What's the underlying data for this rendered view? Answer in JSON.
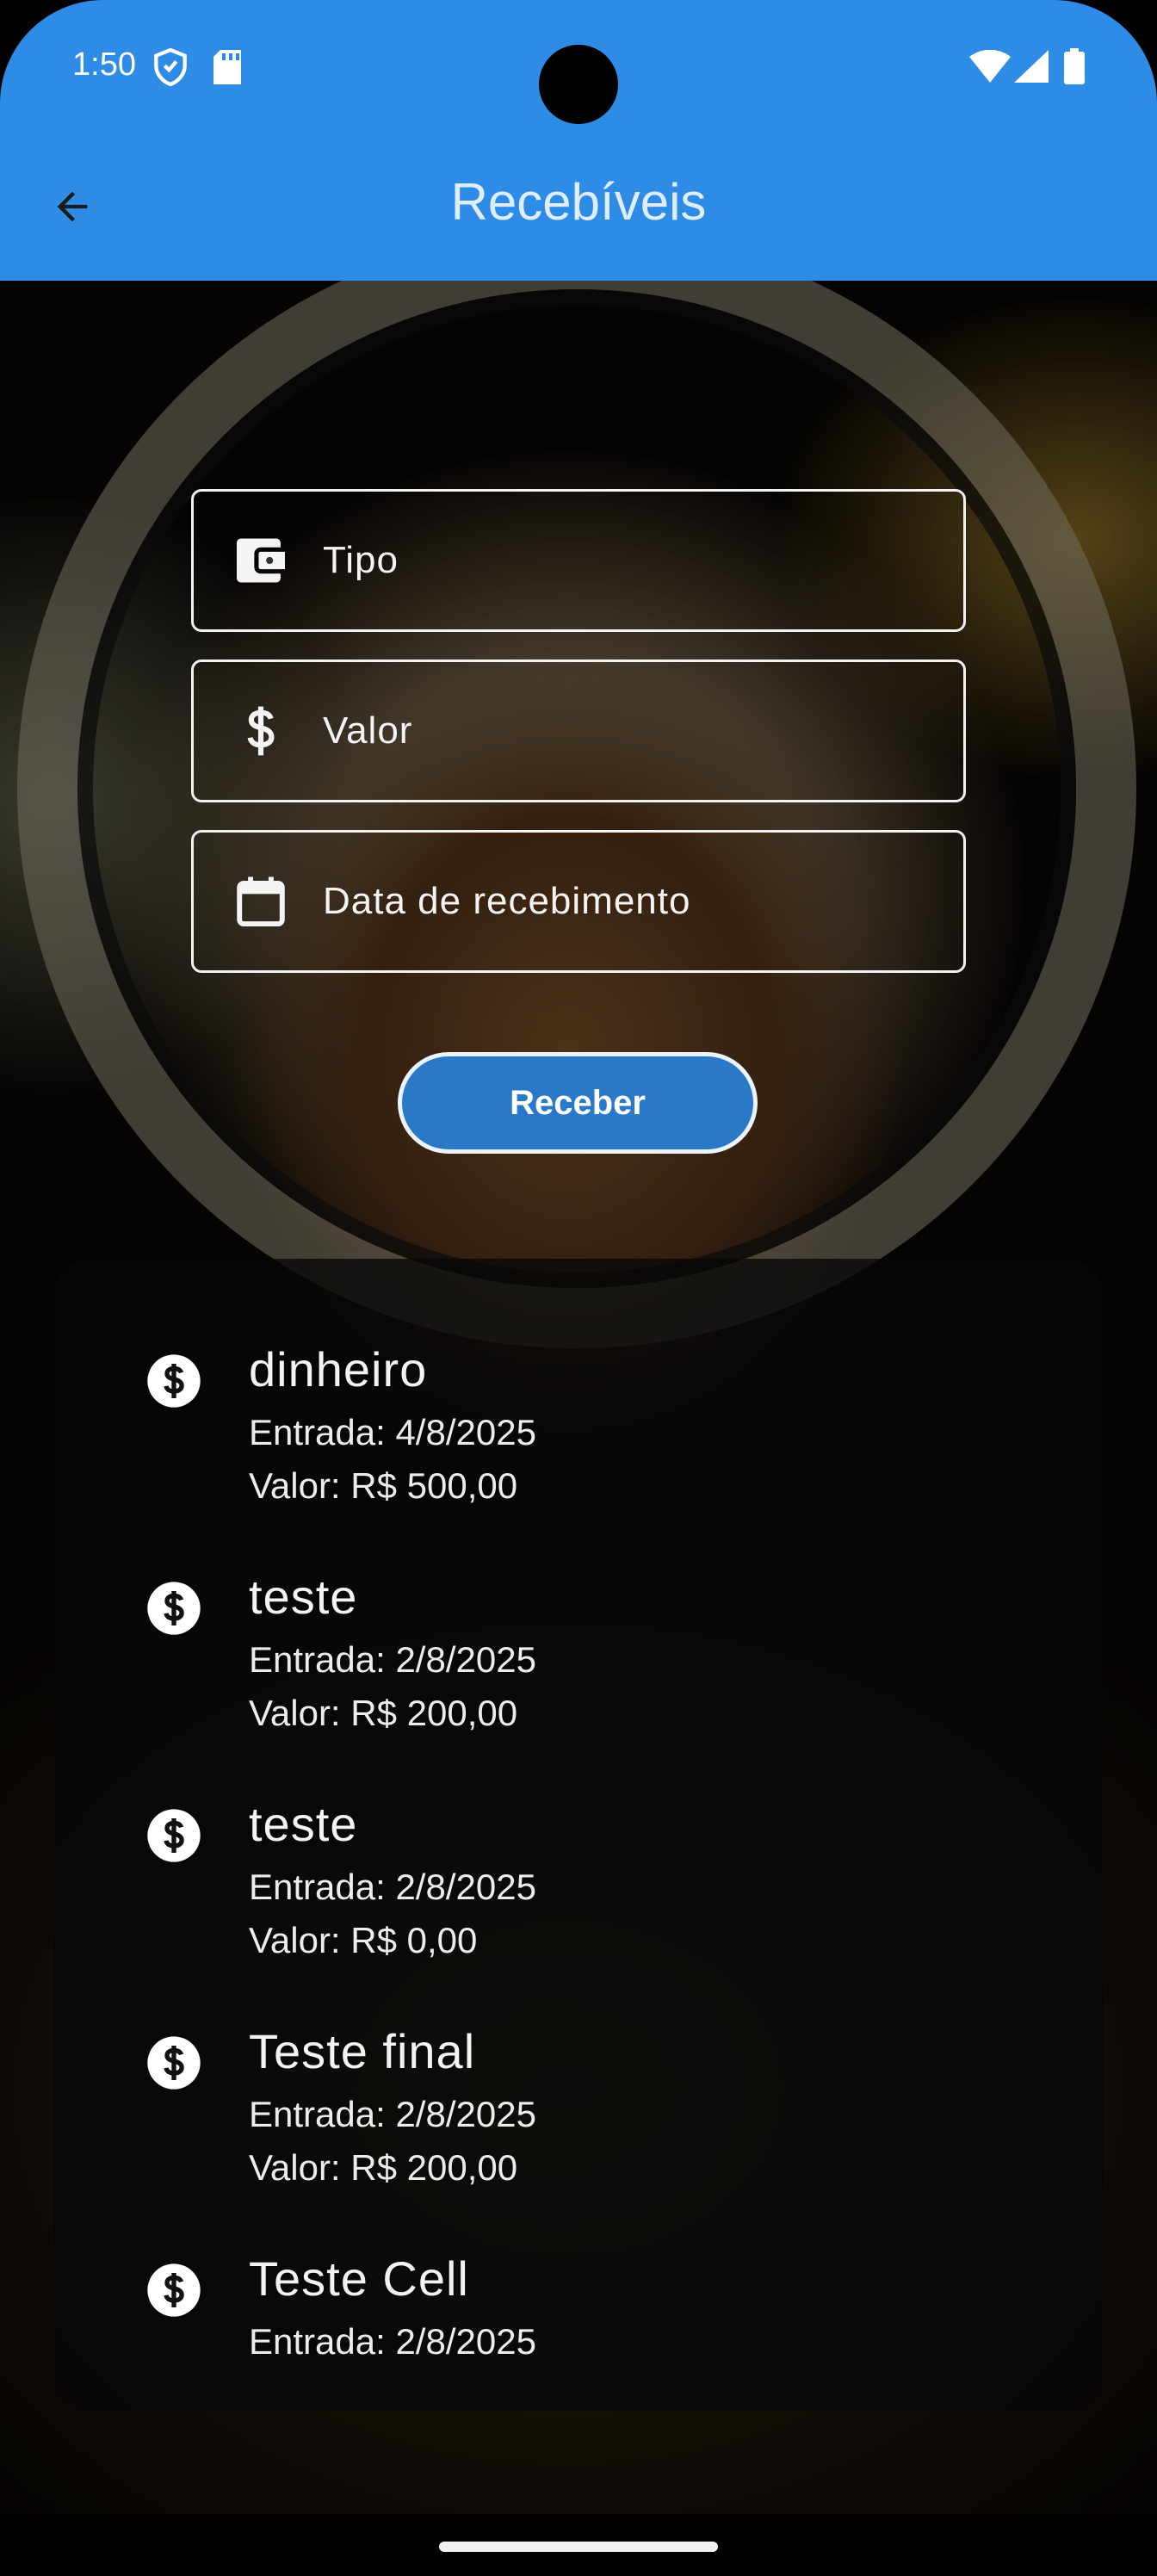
{
  "status_bar": {
    "time": "1:50"
  },
  "app_bar": {
    "title": "Recebíveis",
    "back_icon": "arrow-left-icon"
  },
  "form": {
    "tipo_label": "Tipo",
    "valor_label": "Valor",
    "data_label": "Data de recebimento",
    "submit_label": "Receber"
  },
  "list": {
    "items": [
      {
        "title": "dinheiro",
        "entrada": "Entrada: 4/8/2025",
        "valor": "Valor: R$ 500,00"
      },
      {
        "title": "teste",
        "entrada": "Entrada: 2/8/2025",
        "valor": "Valor: R$ 200,00"
      },
      {
        "title": "teste",
        "entrada": "Entrada: 2/8/2025",
        "valor": "Valor: R$ 0,00"
      },
      {
        "title": "Teste final",
        "entrada": "Entrada: 2/8/2025",
        "valor": "Valor: R$ 200,00"
      },
      {
        "title": "Teste Cell",
        "entrada": "Entrada: 2/8/2025"
      }
    ]
  },
  "colors": {
    "app_bar": "#2e8be6",
    "button": "#2a78c8"
  }
}
